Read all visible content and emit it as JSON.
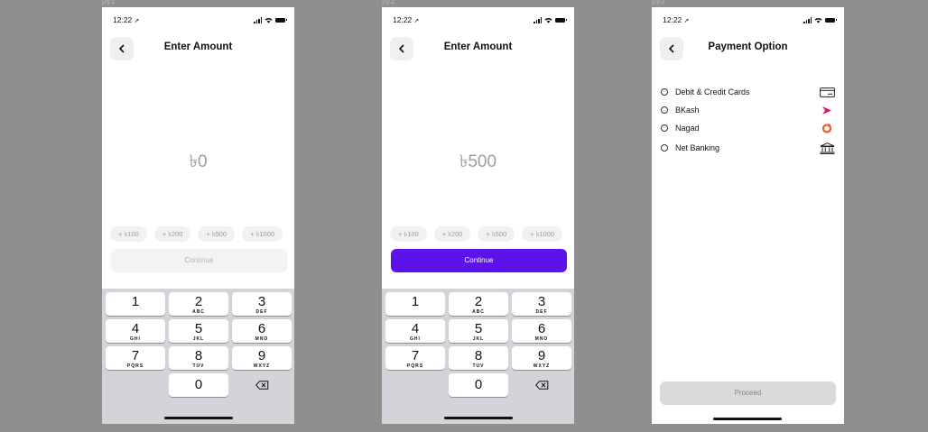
{
  "frames": [
    {
      "label": "py1",
      "time": "12:22",
      "title": "Enter Amount",
      "amount": "৳0",
      "chips": [
        "+ ৳100",
        "+ ৳200",
        "+ ৳500",
        "+ ৳1000"
      ],
      "continue_label": "Continue",
      "continue_state": "disabled"
    },
    {
      "label": "py2",
      "time": "12:22",
      "title": "Enter Amount",
      "amount": "৳500",
      "chips": [
        "+ ৳100",
        "+ ৳200",
        "+ ৳500",
        "+ ৳1000"
      ],
      "continue_label": "Continue",
      "continue_state": "active"
    },
    {
      "label": "py3",
      "time": "12:22",
      "title": "Payment Option",
      "options": [
        {
          "label": "Debit & Credit Cards",
          "icon": "credit-card-icon"
        },
        {
          "label": "BKash",
          "icon": "bkash-icon"
        },
        {
          "label": "Nagad",
          "icon": "nagad-icon"
        },
        {
          "label": "Net Banking",
          "icon": "bank-icon"
        }
      ],
      "proceed_label": "Proceed"
    }
  ],
  "keypad": [
    {
      "num": "1",
      "letters": ""
    },
    {
      "num": "2",
      "letters": "ABC"
    },
    {
      "num": "3",
      "letters": "DEF"
    },
    {
      "num": "4",
      "letters": "GHI"
    },
    {
      "num": "5",
      "letters": "JKL"
    },
    {
      "num": "6",
      "letters": "MNO"
    },
    {
      "num": "7",
      "letters": "PQRS"
    },
    {
      "num": "8",
      "letters": "TUV"
    },
    {
      "num": "9",
      "letters": "WXYZ"
    },
    {
      "num": "0",
      "letters": ""
    }
  ],
  "colors": {
    "accent": "#5b13ea",
    "background": "#8f8f8f",
    "bkash": "#e2136e",
    "nagad": "#f15a22"
  }
}
